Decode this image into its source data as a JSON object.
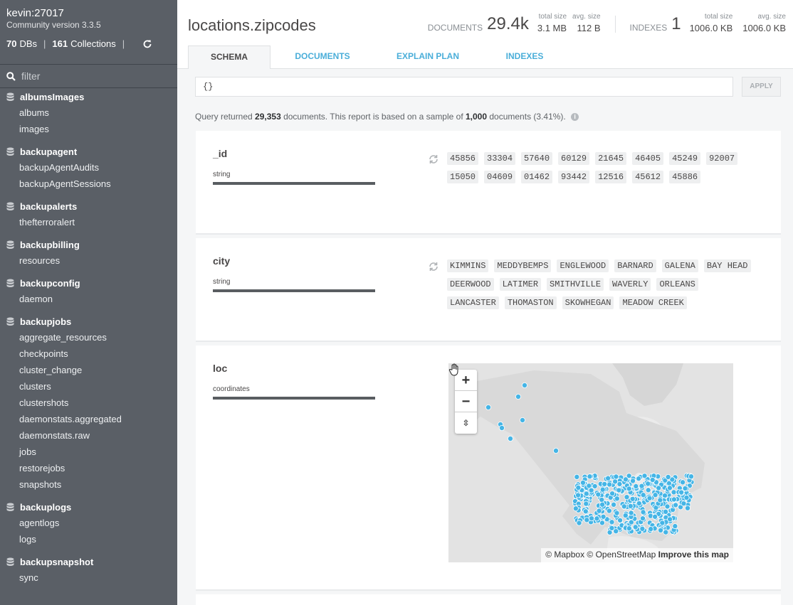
{
  "sidebar": {
    "host": "kevin:27017",
    "version": "Community version 3.3.5",
    "db_count": "70",
    "db_label": "DBs",
    "collection_count": "161",
    "collection_label": "Collections",
    "filter_placeholder": "filter",
    "databases": [
      {
        "name": "albumsImages",
        "collections": [
          "albums",
          "images"
        ]
      },
      {
        "name": "backupagent",
        "collections": [
          "backupAgentAudits",
          "backupAgentSessions"
        ]
      },
      {
        "name": "backupalerts",
        "collections": [
          "thefterroralert"
        ]
      },
      {
        "name": "backupbilling",
        "collections": [
          "resources"
        ]
      },
      {
        "name": "backupconfig",
        "collections": [
          "daemon"
        ]
      },
      {
        "name": "backupjobs",
        "collections": [
          "aggregate_resources",
          "checkpoints",
          "cluster_change",
          "clusters",
          "clustershots",
          "daemonstats.aggregated",
          "daemonstats.raw",
          "jobs",
          "restorejobs",
          "snapshots"
        ]
      },
      {
        "name": "backuplogs",
        "collections": [
          "agentlogs",
          "logs"
        ]
      },
      {
        "name": "backupsnapshot",
        "collections": [
          "sync"
        ]
      }
    ]
  },
  "header": {
    "title": "locations.zipcodes",
    "documents_label": "DOCUMENTS",
    "documents_value": "29.4k",
    "doc_total_size_label": "total size",
    "doc_total_size": "3.1 MB",
    "doc_avg_size_label": "avg. size",
    "doc_avg_size": "112 B",
    "indexes_label": "INDEXES",
    "indexes_value": "1",
    "idx_total_size_label": "total size",
    "idx_total_size": "1006.0 KB",
    "idx_avg_size_label": "avg. size",
    "idx_avg_size": "1006.0 KB"
  },
  "tabs": [
    "SCHEMA",
    "DOCUMENTS",
    "EXPLAIN PLAN",
    "INDEXES"
  ],
  "query": {
    "value": "{}",
    "apply_label": "APPLY",
    "info_pre": "Query returned ",
    "returned": "29,353",
    "info_mid": " documents. This report is based on a sample of ",
    "sample": "1,000",
    "info_post": " documents (3.41%)."
  },
  "fields": [
    {
      "name": "_id",
      "type": "string",
      "values": [
        "45856",
        "33304",
        "57640",
        "60129",
        "21645",
        "46405",
        "45249",
        "92007",
        "15050",
        "04609",
        "01462",
        "93442",
        "12516",
        "45612",
        "45886"
      ]
    },
    {
      "name": "city",
      "type": "string",
      "values": [
        "KIMMINS",
        "MEDDYBEMPS",
        "ENGLEWOOD",
        "BARNARD",
        "GALENA",
        "BAY HEAD",
        "DEERWOOD",
        "LATIMER",
        "SMITHVILLE",
        "WAVERLY",
        "ORLEANS",
        "LANCASTER",
        "THOMASTON",
        "SKOWHEGAN",
        "MEADOW CREEK"
      ]
    },
    {
      "name": "loc",
      "type": "coordinates"
    }
  ],
  "map": {
    "zoom_in": "+",
    "zoom_out": "−",
    "reset": "⇳",
    "attribution": "© Mapbox © OpenStreetMap",
    "improve": "Improve this map",
    "point_color": "#45b5e6"
  }
}
